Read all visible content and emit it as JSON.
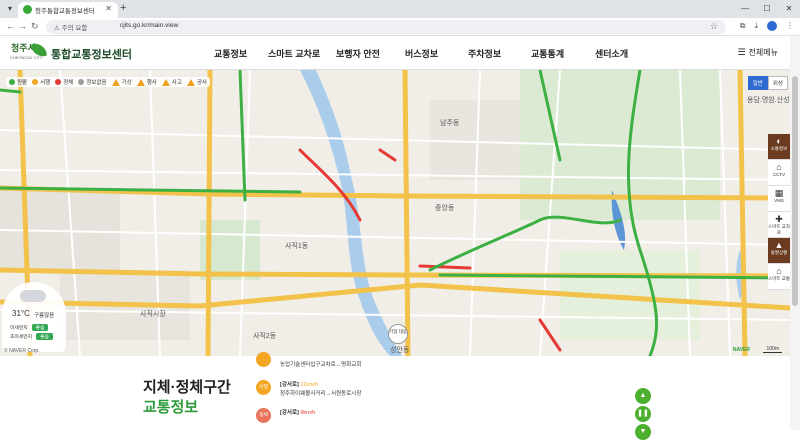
{
  "browser": {
    "tab_title": "청주통합교통정보센터",
    "security_label": "주의 요함",
    "url": "cjits.go.kr/main.view"
  },
  "header": {
    "logo_city": "청주시",
    "logo_sub": "CHEONGJU CITY",
    "logo_text": "통합교통정보센터",
    "menu": [
      "교통정보",
      "스마트 교차로",
      "보행자 안전",
      "버스정보",
      "주차정보",
      "교통통계",
      "센터소개"
    ],
    "all_menu": "전체메뉴"
  },
  "map": {
    "legend": [
      {
        "label": "원활",
        "color": "#3cb043",
        "shape": "dot"
      },
      {
        "label": "서행",
        "color": "#f5a623",
        "shape": "dot"
      },
      {
        "label": "정체",
        "color": "#e53935",
        "shape": "dot"
      },
      {
        "label": "정보없음",
        "color": "#9e9e9e",
        "shape": "dot"
      },
      {
        "label": "기상",
        "color": "#f0a020",
        "shape": "tri"
      },
      {
        "label": "행사",
        "color": "#f0a020",
        "shape": "tri"
      },
      {
        "label": "사고",
        "color": "#f0a020",
        "shape": "tri"
      },
      {
        "label": "공사",
        "color": "#f0a020",
        "shape": "tri"
      }
    ],
    "day_label": "일반",
    "night_label": "위성",
    "tools": [
      {
        "label": "소통정보",
        "icon": "traffic-icon"
      },
      {
        "label": "CCTV",
        "icon": "cctv-icon"
      },
      {
        "label": "VMS",
        "icon": "vms-icon"
      },
      {
        "label": "스마트 교차로",
        "icon": "intersection-icon"
      },
      {
        "label": "돌발상황",
        "icon": "incident-icon"
      },
      {
        "label": "스마트 교통",
        "icon": "building-icon"
      }
    ],
    "place_labels": [
      {
        "text": "사직1동"
      },
      {
        "text": "사직2동"
      },
      {
        "text": "중앙동"
      },
      {
        "text": "성안동"
      },
      {
        "text": "용담.명암.산성동"
      },
      {
        "text": "사직시장"
      },
      {
        "text": "남주동"
      }
    ],
    "center_button": "기업 대응",
    "copyright": "© NAVER Corp.",
    "naver": "NAVER",
    "scale": "100m"
  },
  "weather": {
    "temp": "31°C",
    "desc": "구름많음",
    "dust_label": "미세먼지",
    "dust_value": "좋음",
    "fine_dust_label": "초미세먼지",
    "fine_dust_value": "좋음"
  },
  "bottom": {
    "title_line1": "지체·정체구간",
    "title_line2": "교통정보",
    "jam_items": [
      {
        "badge": "",
        "badge_color": "#f5a623",
        "dir": "",
        "speed": "",
        "route": "농업기술센터입구교차로→명화교회"
      },
      {
        "badge": "서행",
        "badge_color": "#f5a623",
        "dir": "[강서로]",
        "speed": "11km/h",
        "route": "청주하이웨몰사거리→서원동로시장"
      },
      {
        "badge": "정체",
        "badge_color": "#e8735a",
        "dir": "[강서로]",
        "speed": "9km/h",
        "route": ""
      }
    ],
    "controls": [
      "up-button",
      "pause-button",
      "down-button"
    ]
  }
}
